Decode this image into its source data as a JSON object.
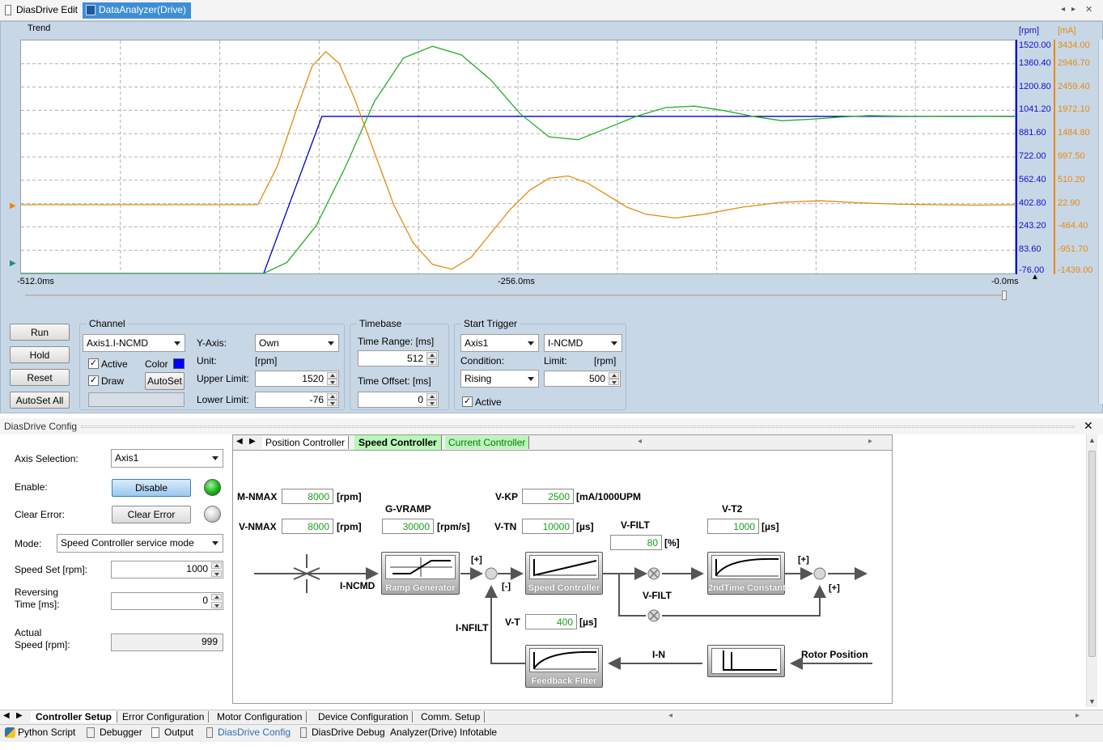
{
  "top_tabs": [
    {
      "label": "DiasDrive Edit",
      "icon": "document-icon"
    },
    {
      "label": "DataAnalyzer(Drive)",
      "icon": "chart-icon"
    }
  ],
  "trend": {
    "title": "Trend",
    "unit_left": "[rpm]",
    "unit_right": "[mA]",
    "rpm_ticks": [
      "1520.00",
      "1360.40",
      "1200.80",
      "1041.20",
      "881.60",
      "722.00",
      "562.40",
      "402.80",
      "243.20",
      "83.60",
      "-76.00"
    ],
    "ma_ticks": [
      "3434.00",
      "2946.70",
      "2459.40",
      "1972.10",
      "1484.80",
      "997.50",
      "510.20",
      "22.90",
      "-464.40",
      "-951.70",
      "-1439.00"
    ],
    "time_ticks": [
      "-512.0ms",
      "-256.0ms",
      "-0.0ms"
    ]
  },
  "chart_data": {
    "type": "line",
    "x_unit": "ms",
    "xlim": [
      -512,
      0
    ],
    "ylim_rpm": [
      -76,
      1520
    ],
    "ylim_ma": [
      -1439,
      3434
    ],
    "grid": true,
    "series": [
      {
        "name": "Axis1.I-NCMD",
        "axis": "rpm",
        "color": "#0000c8",
        "x": [
          -512,
          -387,
          -357,
          0
        ],
        "y": [
          -76,
          -76,
          1000,
          1000
        ]
      },
      {
        "name": "",
        "axis": "rpm",
        "color": "#22b022",
        "x": [
          -512,
          -387,
          -375,
          -360,
          -345,
          -330,
          -315,
          -300,
          -285,
          -270,
          -255,
          -240,
          -225,
          -210,
          -195,
          -180,
          -165,
          -150,
          -135,
          -120,
          -105,
          -90,
          -75,
          -60,
          -45,
          -30,
          -15,
          0
        ],
        "y": [
          -76,
          -76,
          0,
          250,
          650,
          1100,
          1400,
          1480,
          1420,
          1250,
          1020,
          860,
          840,
          920,
          1000,
          1060,
          1070,
          1040,
          1000,
          970,
          980,
          995,
          1005,
          1002,
          1000,
          999,
          1000,
          999
        ]
      },
      {
        "name": "",
        "axis": "ma",
        "color": "#e48a10",
        "x": [
          -512,
          -390,
          -380,
          -370,
          -362,
          -355,
          -348,
          -340,
          -330,
          -320,
          -310,
          -300,
          -290,
          -280,
          -270,
          -260,
          -250,
          -240,
          -230,
          -220,
          -210,
          -200,
          -190,
          -175,
          -160,
          -140,
          -120,
          -100,
          -80,
          -60,
          -40,
          -20,
          0
        ],
        "y": [
          0,
          0,
          800,
          2000,
          2900,
          3200,
          2950,
          2200,
          1100,
          0,
          -800,
          -1250,
          -1350,
          -1100,
          -600,
          -100,
          300,
          550,
          600,
          450,
          200,
          -50,
          -200,
          -280,
          -200,
          -50,
          50,
          80,
          40,
          10,
          0,
          -10,
          0
        ]
      }
    ]
  },
  "controls": {
    "run": "Run",
    "hold": "Hold",
    "reset": "Reset",
    "autoset_all": "AutoSet All",
    "channel": {
      "title": "Channel",
      "selected": "Axis1.I-NCMD",
      "active": "Active",
      "draw": "Draw",
      "color_label": "Color",
      "color": "#0000ff",
      "autoset": "AutoSet",
      "yaxis_label": "Y-Axis:",
      "yaxis": "Own",
      "unit_label": "Unit:",
      "unit": "[rpm]",
      "upper_label": "Upper Limit:",
      "upper": "1520",
      "lower_label": "Lower Limit:",
      "lower": "-76"
    },
    "timebase": {
      "title": "Timebase",
      "range_label": "Time Range: [ms]",
      "range": "512",
      "offset_label": "Time Offset: [ms]",
      "offset": "0"
    },
    "trigger": {
      "title": "Start Trigger",
      "axis": "Axis1",
      "signal": "I-NCMD",
      "condition_label": "Condition:",
      "condition": "Rising",
      "limit_label": "Limit:",
      "limit_unit": "[rpm]",
      "limit": "500",
      "active": "Active"
    }
  },
  "config": {
    "title": "DiasDrive Config",
    "axis_label": "Axis Selection:",
    "axis": "Axis1",
    "enable_label": "Enable:",
    "enable_button": "Disable",
    "clear_label": "Clear Error:",
    "clear_button": "Clear Error",
    "mode_label": "Mode:",
    "mode": "Speed Controller service mode",
    "speed_label": "Speed Set [rpm]:",
    "speed": "1000",
    "rev_label1": "Reversing",
    "rev_label2": "Time [ms]:",
    "rev": "0",
    "actual_label1": "Actual",
    "actual_label2": "Speed [rpm]:",
    "actual": "999",
    "tabs": [
      "Position Controller",
      "Speed Controller",
      "Current Controller"
    ]
  },
  "diagram": {
    "m_nmax_label": "M-NMAX",
    "m_nmax": "8000",
    "m_nmax_unit": "[rpm]",
    "v_nmax_label": "V-NMAX",
    "v_nmax": "8000",
    "v_nmax_unit": "[rpm]",
    "g_vramp_label": "G-VRAMP",
    "g_vramp": "30000",
    "g_vramp_unit": "[rpm/s]",
    "v_kp_label": "V-KP",
    "v_kp": "2500",
    "v_kp_unit": "[mA/1000UPM",
    "v_tn_label": "V-TN",
    "v_tn": "10000",
    "v_tn_unit": "[µs]",
    "v_filt_label": "V-FILT",
    "v_filt": "80",
    "v_filt_unit": "[%]",
    "v_t2_label": "V-T2",
    "v_t2": "1000",
    "v_t2_unit": "[µs]",
    "v_t_label": "V-T",
    "v_t": "400",
    "v_t_unit": "[µs]",
    "i_ncmd": "I-NCMD",
    "i_nfilt": "I-NFILT",
    "i_n": "I-N",
    "v_filt2": "V-FILT",
    "rotor": "Rotor Position",
    "ramp": "Ramp Generator",
    "speed_ctrl": "Speed Controller",
    "time_const": "2ndTime Constant",
    "feedback": "Feedback Filter",
    "plus": "[+]",
    "minus": "[-]"
  },
  "bottom_tabs": [
    "Controller Setup",
    "Error Configuration",
    "Motor Configuration",
    "Device Configuration",
    "Comm. Setup"
  ],
  "status_tabs": [
    {
      "label": "Python Script",
      "icon": "python-icon"
    },
    {
      "label": "Debugger",
      "icon": "debugger-icon"
    },
    {
      "label": "Output",
      "icon": "output-icon"
    },
    {
      "label": "DiasDrive Config",
      "icon": "config-icon"
    },
    {
      "label": "DiasDrive Debug",
      "icon": "debug-icon"
    },
    {
      "label": "Analyzer(Drive) Infotable",
      "icon": ""
    }
  ]
}
